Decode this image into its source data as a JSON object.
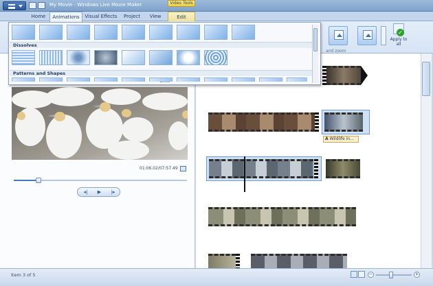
{
  "window": {
    "title": "My Movie - Windows Live Movie Maker",
    "context_tab_header": "Video Tools"
  },
  "tabs": [
    {
      "label": "Home"
    },
    {
      "label": "Animations"
    },
    {
      "label": "Visual Effects"
    },
    {
      "label": "Project"
    },
    {
      "label": "View"
    },
    {
      "label": "Edit"
    }
  ],
  "active_tab": "Animations",
  "ribbon": {
    "apply_to_all": "Apply to all",
    "pan_zoom_group": "and zoom"
  },
  "gallery": {
    "sections": [
      {
        "header": ""
      },
      {
        "header": "Dissolves"
      },
      {
        "header": "Patterns and Shapes"
      }
    ]
  },
  "preview": {
    "timecode": "01:06.02/07:57.49",
    "seek_position": 0.14
  },
  "playback": {
    "prev_frame": "◂|",
    "play": "▶",
    "next_frame": "|▸"
  },
  "storyboard": {
    "caption_text": "Wildlife in...",
    "caption_icon": "A"
  },
  "status": {
    "item": "Item 3 of 5",
    "zoom_minus": "−",
    "zoom_plus": "+"
  },
  "colors": {
    "accent": "#3d79c6",
    "context_tab": "#e6cf4a",
    "selection": "#6b9bd6"
  }
}
